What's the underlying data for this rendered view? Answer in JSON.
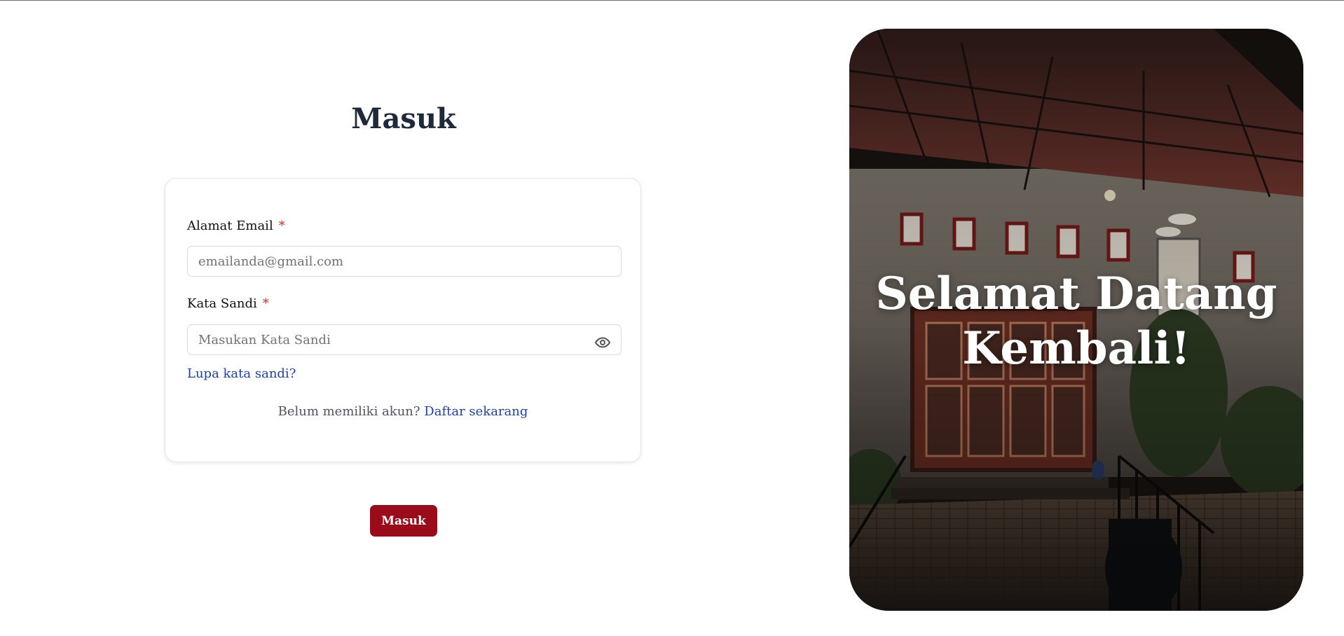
{
  "login": {
    "title": "Masuk",
    "email_label": "Alamat Email",
    "email_required": "*",
    "email_placeholder": "emailanda@gmail.com",
    "email_value": "",
    "password_label": "Kata Sandi",
    "password_required": "*",
    "password_placeholder": "Masukan Kata Sandi",
    "password_value": "",
    "password_toggle_icon": "eye-icon",
    "forgot_link": "Lupa kata sandi?",
    "signup_prompt": "Belum memiliki akun?",
    "signup_link": "Daftar sekarang",
    "submit_label": "Masuk"
  },
  "hero": {
    "heading_line1": "Selamat Datang",
    "heading_line2": "Kembali!"
  },
  "colors": {
    "primary": "#9b0c1b",
    "link": "#1e40af",
    "required": "#dc2626",
    "title": "#1e293b"
  }
}
